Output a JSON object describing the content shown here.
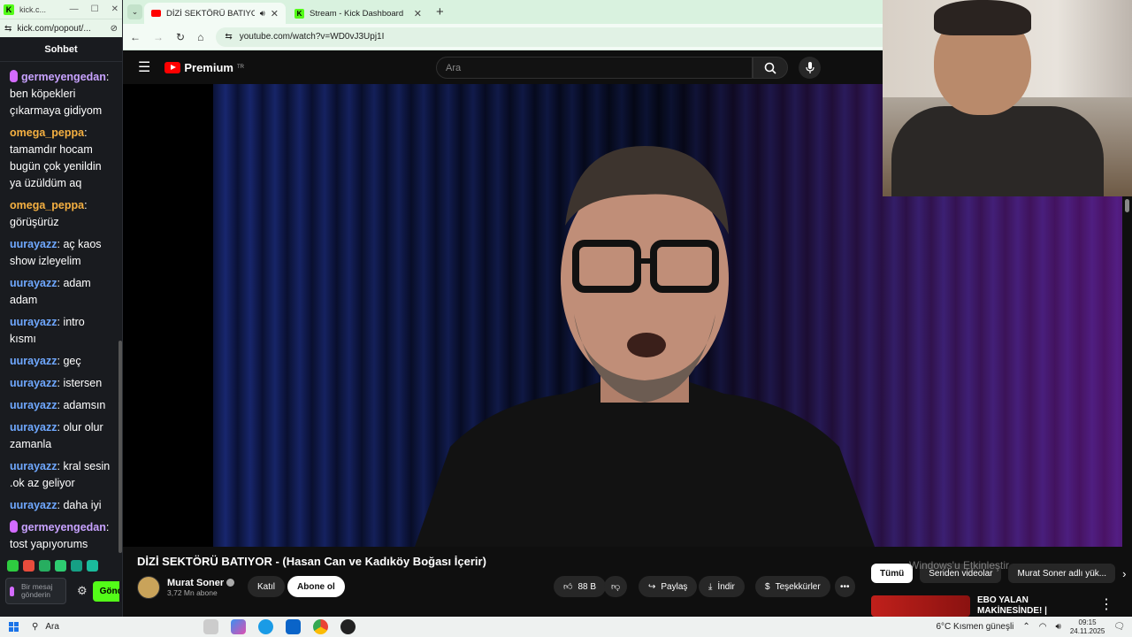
{
  "kick": {
    "window_title": "kick.c...",
    "url": "kick.com/popout/...",
    "chat_title": "Sohbet",
    "messages": [
      {
        "user": "germeyengedan",
        "text": ": ben köpekleri çıkarmaya gidiyom",
        "color": "germe",
        "mic": true
      },
      {
        "user": "omega_peppa",
        "text": ": tamamdır hocam bugün çok yenildin ya üzüldüm aq",
        "color": "omega",
        "mic": false
      },
      {
        "user": "omega_peppa",
        "text": ": görüşürüz",
        "color": "omega",
        "mic": false
      },
      {
        "user": "uurayazz",
        "text": ": aç kaos show izleyelim",
        "color": "uuray",
        "mic": false
      },
      {
        "user": "uurayazz",
        "text": ": adam adam",
        "color": "uuray",
        "mic": false
      },
      {
        "user": "uurayazz",
        "text": ": intro kısmı",
        "color": "uuray",
        "mic": false
      },
      {
        "user": "uurayazz",
        "text": ": geç",
        "color": "uuray",
        "mic": false
      },
      {
        "user": "uurayazz",
        "text": ": istersen",
        "color": "uuray",
        "mic": false
      },
      {
        "user": "uurayazz",
        "text": ": adamsın",
        "color": "uuray",
        "mic": false
      },
      {
        "user": "uurayazz",
        "text": ": olur olur zamanla",
        "color": "uuray",
        "mic": false
      },
      {
        "user": "uurayazz",
        "text": ": kral sesin .ok az geliyor",
        "color": "uuray",
        "mic": false
      },
      {
        "user": "uurayazz",
        "text": ": daha iyi",
        "color": "uuray",
        "mic": false
      },
      {
        "user": "germeyengedan",
        "text": ": tost yapıyorums",
        "color": "germe",
        "mic": true
      }
    ],
    "input_placeholder": "Bir mesaj gönderin",
    "send_label": "Gönder",
    "emote_colors": [
      "#2ecc40",
      "#e74c3c",
      "#27ae60",
      "#2ecc71",
      "#16a085",
      "#1abc9c"
    ]
  },
  "browser": {
    "tabs": [
      {
        "title": "DİZİ SEKTÖRÜ BATIYOR - (H...",
        "favicon": "youtube-icon",
        "active": true
      },
      {
        "title": "Stream - Kick Dashboard",
        "favicon": "kick-icon",
        "active": false
      }
    ],
    "url": "youtube.com/watch?v=WD0vJ3Upj1I"
  },
  "youtube": {
    "logo_text": "Premium",
    "region": "TR",
    "search_placeholder": "Ara",
    "video_title": "DİZİ SEKTÖRÜ BATIYOR - (Hasan Can ve Kadıköy Boğası İçerir)",
    "channel_name": "Murat Soner",
    "subscribers": "3,72 Mn abone",
    "join_label": "Katıl",
    "subscribe_label": "Abone ol",
    "likes": "88 B",
    "share_label": "Paylaş",
    "download_label": "İndir",
    "thanks_label": "Teşekkürler",
    "chips": [
      "Tümü",
      "Seriden videolar",
      "Murat Soner adlı yük..."
    ],
    "watermark": "Windows'u Etkinleştir",
    "rec_title": "EBO YALAN MAKİNESİNDE! | #pembeyalanlar"
  },
  "taskbar": {
    "search_label": "Ara",
    "weather": "6°C  Kısmen güneşli",
    "time": "09:15",
    "date": "24.11.2025"
  }
}
